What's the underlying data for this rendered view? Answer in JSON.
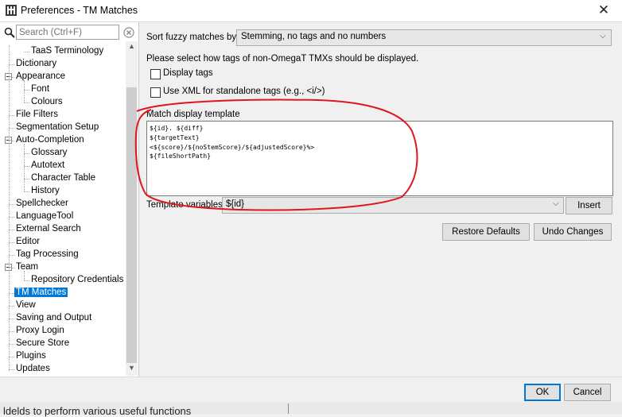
{
  "window": {
    "title": "Preferences - TM Matches",
    "icon": "omegat-app-icon",
    "close_glyph": "✕"
  },
  "search": {
    "placeholder": "Search (Ctrl+F)"
  },
  "tree": {
    "items": [
      {
        "label": "TaaS Terminology",
        "level": 2
      },
      {
        "label": "Dictionary",
        "level": 1
      },
      {
        "label": "Appearance",
        "level": 1,
        "expanded": true
      },
      {
        "label": "Font",
        "level": 2
      },
      {
        "label": "Colours",
        "level": 2
      },
      {
        "label": "File Filters",
        "level": 1
      },
      {
        "label": "Segmentation Setup",
        "level": 1
      },
      {
        "label": "Auto-Completion",
        "level": 1,
        "expanded": true
      },
      {
        "label": "Glossary",
        "level": 2
      },
      {
        "label": "Autotext",
        "level": 2
      },
      {
        "label": "Character Table",
        "level": 2
      },
      {
        "label": "History",
        "level": 2
      },
      {
        "label": "Spellchecker",
        "level": 1
      },
      {
        "label": "LanguageTool",
        "level": 1
      },
      {
        "label": "External Search",
        "level": 1
      },
      {
        "label": "Editor",
        "level": 1
      },
      {
        "label": "Tag Processing",
        "level": 1
      },
      {
        "label": "Team",
        "level": 1,
        "expanded": true
      },
      {
        "label": "Repository Credentials",
        "level": 2
      },
      {
        "label": "TM Matches",
        "level": 1,
        "selected": true
      },
      {
        "label": "View",
        "level": 1
      },
      {
        "label": "Saving and Output",
        "level": 1
      },
      {
        "label": "Proxy Login",
        "level": 1
      },
      {
        "label": "Secure Store",
        "level": 1
      },
      {
        "label": "Plugins",
        "level": 1
      },
      {
        "label": "Updates",
        "level": 1
      }
    ]
  },
  "content": {
    "fuzzy_label": "Sort fuzzy matches by:",
    "fuzzy_value": "Stemming, no tags and no numbers",
    "tags_text": "Please select how tags of non-OmegaT TMXs should be displayed.",
    "display_tags_label": "Display tags",
    "display_tags_checked": false,
    "use_xml_label": "Use XML for standalone tags (e.g., <i/>)",
    "use_xml_checked": false,
    "template_label": "Match display template",
    "template_text": "${id}. ${diff}\n${targetText}\n<${score}/${noStemScore}/${adjustedScore}%>\n${fileShortPath}",
    "template_vars_label": "Template variables:",
    "template_vars_value": "${id}",
    "insert_label": "Insert",
    "restore_label": "Restore Defaults",
    "undo_label": "Undo Changes"
  },
  "footer": {
    "ok_label": "OK",
    "cancel_label": "Cancel"
  },
  "background": {
    "text": "ldelds to perform various useful functions"
  },
  "colors": {
    "selection": "#0078d7",
    "annotation": "#e0161e"
  }
}
